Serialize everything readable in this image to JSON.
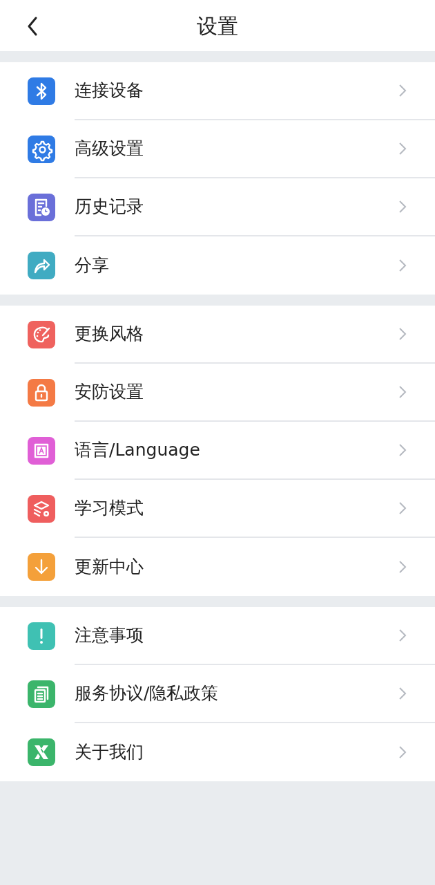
{
  "header": {
    "title": "设置"
  },
  "sections": [
    {
      "items": [
        {
          "label": "连接设备",
          "kind": "bluetooth",
          "color": "#2f7be5"
        },
        {
          "label": "高级设置",
          "kind": "gear",
          "color": "#2f7be5"
        },
        {
          "label": "历史记录",
          "kind": "history",
          "color": "#6a6fd9"
        },
        {
          "label": "分享",
          "kind": "share",
          "color": "#40abc2"
        }
      ]
    },
    {
      "items": [
        {
          "label": "更换风格",
          "kind": "palette",
          "color": "#ef625e"
        },
        {
          "label": "安防设置",
          "kind": "lock",
          "color": "#f47a45"
        },
        {
          "label": "语言/Language",
          "kind": "frame",
          "color": "#e05fd6"
        },
        {
          "label": "学习模式",
          "kind": "layers",
          "color": "#ef5e5e"
        },
        {
          "label": "更新中心",
          "kind": "download",
          "color": "#f4a03a"
        }
      ]
    },
    {
      "items": [
        {
          "label": "注意事项",
          "kind": "alert",
          "color": "#3fc1b3"
        },
        {
          "label": "服务协议/隐私政策",
          "kind": "document",
          "color": "#3bb56b"
        },
        {
          "label": "关于我们",
          "kind": "cross",
          "color": "#3bb56b"
        }
      ]
    }
  ]
}
